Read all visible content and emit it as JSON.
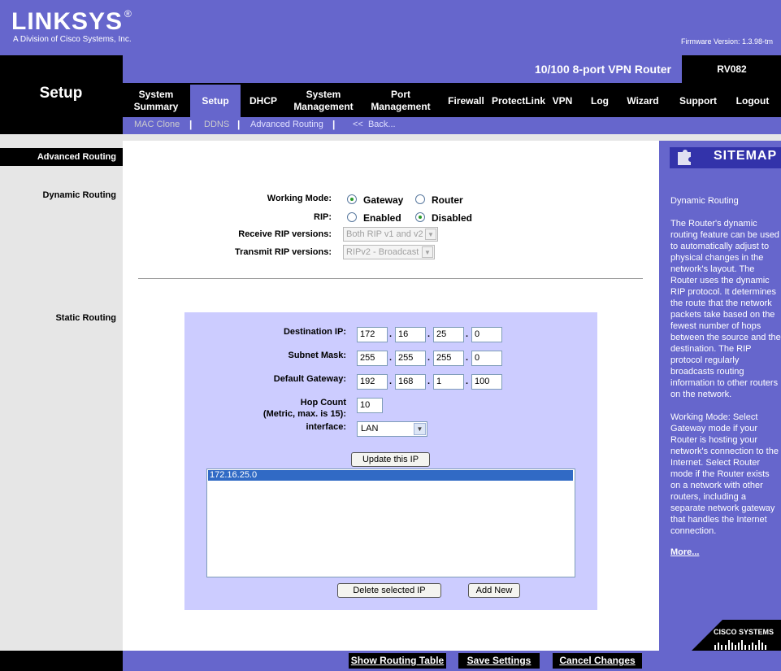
{
  "header": {
    "logo": "LINKSYS",
    "logo_mark": "®",
    "logo_sub": "A Division of Cisco Systems, Inc.",
    "firmware": "Firmware Version: 1.3.98-tm",
    "product": "10/100 8-port VPN Router",
    "model": "RV082"
  },
  "nav": {
    "section_title": "Setup",
    "tabs": [
      {
        "l1": "System",
        "l2": "Summary"
      },
      {
        "l1": "Setup",
        "l2": ""
      },
      {
        "l1": "DHCP",
        "l2": ""
      },
      {
        "l1": "System",
        "l2": "Management"
      },
      {
        "l1": "Port",
        "l2": "Management"
      },
      {
        "l1": "Firewall",
        "l2": ""
      },
      {
        "l1": "ProtectLink",
        "l2": ""
      },
      {
        "l1": "VPN",
        "l2": ""
      },
      {
        "l1": "Log",
        "l2": ""
      },
      {
        "l1": "Wizard",
        "l2": ""
      },
      {
        "l1": "Support",
        "l2": ""
      },
      {
        "l1": "Logout",
        "l2": ""
      }
    ],
    "active_tab": "Setup",
    "subnav": {
      "mac_clone": "MAC Clone",
      "ddns": "DDNS",
      "advanced_routing": "Advanced Routing",
      "back": "<<  Back..."
    }
  },
  "left": {
    "section": "Advanced Routing",
    "dynamic": "Dynamic Routing",
    "static": "Static Routing"
  },
  "dynamic": {
    "working_mode_label": "Working Mode:",
    "gateway": "Gateway",
    "router": "Router",
    "working_mode_selected": "Gateway",
    "rip_label": "RIP:",
    "enabled": "Enabled",
    "disabled": "Disabled",
    "rip_selected": "Disabled",
    "receive_label": "Receive RIP versions:",
    "receive_value": "Both RIP v1 and v2",
    "transmit_label": "Transmit RIP versions:",
    "transmit_value": "RIPv2 - Broadcast"
  },
  "static": {
    "dest_label": "Destination IP:",
    "dest": [
      "172",
      "16",
      "25",
      "0"
    ],
    "mask_label": "Subnet Mask:",
    "mask": [
      "255",
      "255",
      "255",
      "0"
    ],
    "gw_label": "Default Gateway:",
    "gw": [
      "192",
      "168",
      "1",
      "100"
    ],
    "hop_label_1": "Hop Count",
    "hop_label_2": "(Metric, max. is 15):",
    "hop": "10",
    "iface_label": "interface:",
    "iface": "LAN",
    "update_btn": "Update this IP",
    "list": [
      "172.16.25.0"
    ],
    "delete_btn": "Delete selected IP",
    "add_btn": "Add New"
  },
  "sitemap": {
    "title": "SITEMAP",
    "help_title": "Dynamic Routing",
    "help_p1": "The Router's dynamic routing feature can be used to automatically adjust to physical changes in the network's layout. The Router uses the dynamic RIP protocol. It determines the route that the network packets take based on the fewest number of hops between the source and the destination. The RIP protocol regularly broadcasts routing information to other routers on the network.",
    "help_p2": "Working Mode: Select Gateway mode if your Router is hosting your network's connection to the Internet. Select Router mode if the Router exists on a network with other routers, including a separate network gateway that handles the Internet connection.",
    "more": "More...",
    "cisco": "CISCO SYSTEMS"
  },
  "footer": {
    "show_table": "Show Routing Table",
    "save": "Save Settings",
    "cancel": "Cancel Changes"
  },
  "colors": {
    "brand_purple": "#6666cc",
    "panel_lavender": "#ccccff",
    "sitemap_head": "#3333aa"
  }
}
